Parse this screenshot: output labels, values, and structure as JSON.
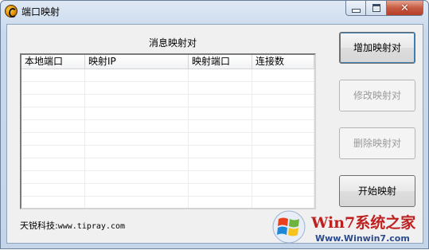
{
  "window": {
    "title": "端口映射"
  },
  "list": {
    "title": "消息映射对",
    "columns": [
      "本地端口",
      "映射IP",
      "映射端口",
      "连接数"
    ],
    "rows": []
  },
  "buttons": {
    "add": "增加映射对",
    "modify": "修改映射对",
    "delete": "删除映射对",
    "start": "开始映射"
  },
  "footer": {
    "company": "天锐科技:",
    "url": "www.tipray.com"
  },
  "watermark": {
    "brand": "Win7系统之家",
    "url": "Www.Winwin7.com"
  },
  "colors": {
    "accent": "#c01f1f",
    "link": "#2b4a8f"
  }
}
